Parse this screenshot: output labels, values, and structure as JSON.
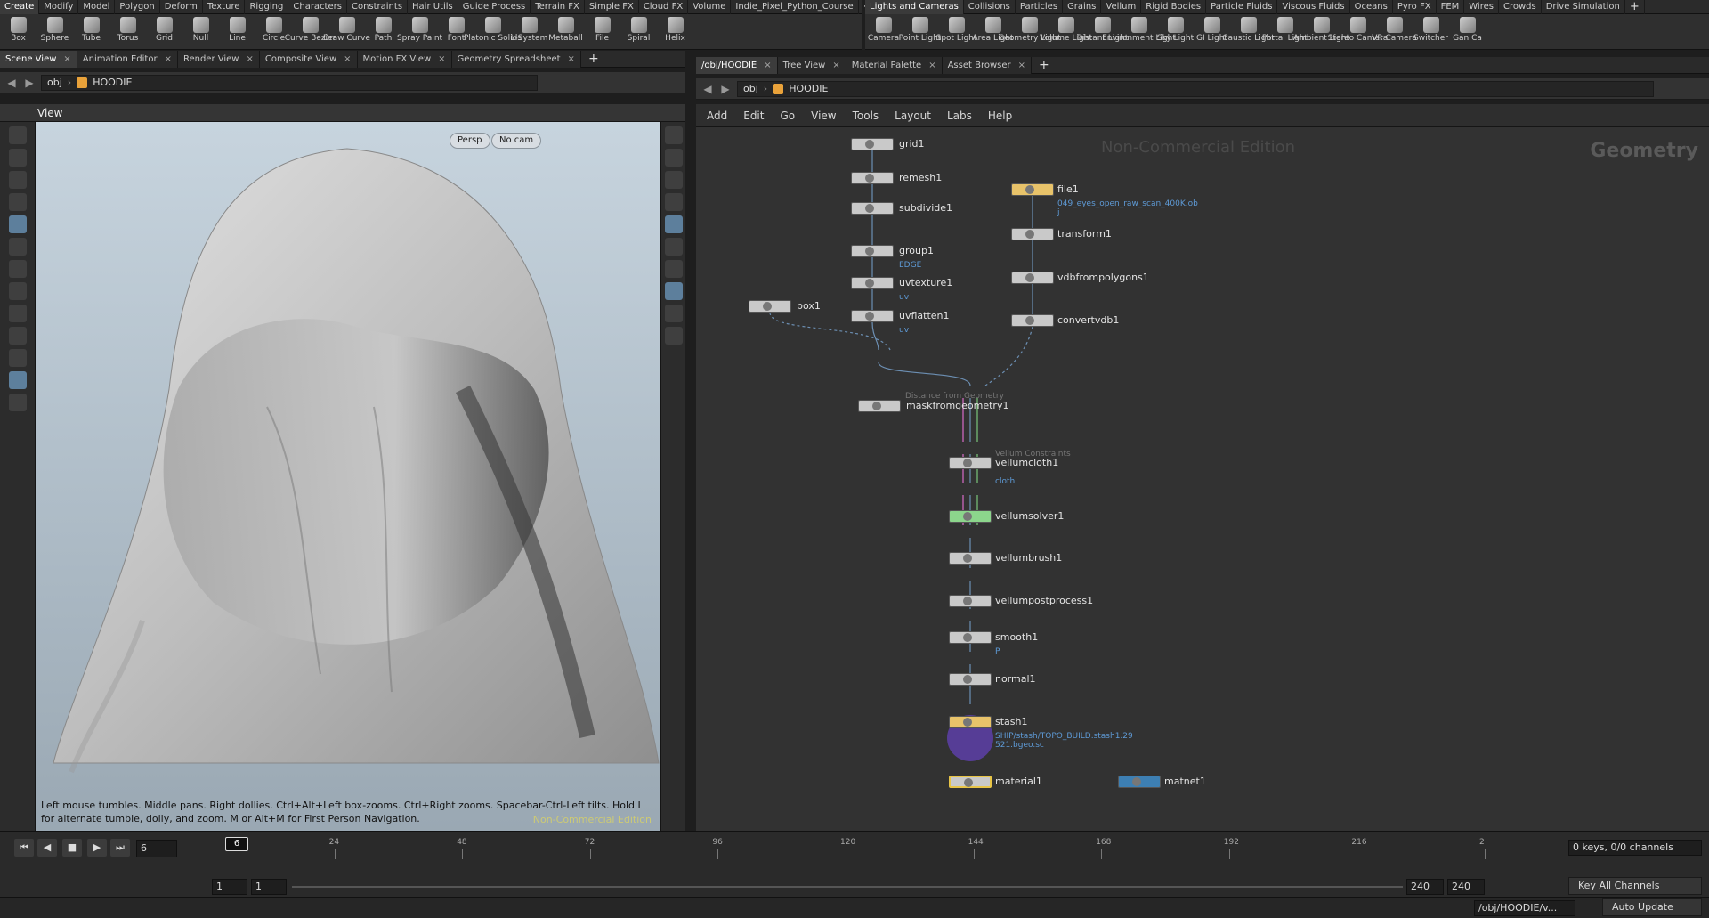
{
  "shelf_left": {
    "tabs": [
      "Create",
      "Modify",
      "Model",
      "Polygon",
      "Deform",
      "Texture",
      "Rigging",
      "Characters",
      "Constraints",
      "Hair Utils",
      "Guide Process",
      "Terrain FX",
      "Simple FX",
      "Cloud FX",
      "Volume",
      "Indie_Pixel_Python_Course"
    ],
    "tools": [
      "Box",
      "Sphere",
      "Tube",
      "Torus",
      "Grid",
      "Null",
      "Line",
      "Circle",
      "Curve Bezier",
      "Draw Curve",
      "Path",
      "Spray Paint",
      "Font",
      "Platonic Solids",
      "L-System",
      "Metaball",
      "File",
      "Spiral",
      "Helix"
    ]
  },
  "shelf_right": {
    "tabs": [
      "Lights and Cameras",
      "Collisions",
      "Particles",
      "Grains",
      "Vellum",
      "Rigid Bodies",
      "Particle Fluids",
      "Viscous Fluids",
      "Oceans",
      "Pyro FX",
      "FEM",
      "Wires",
      "Crowds",
      "Drive Simulation"
    ],
    "tools": [
      "Camera",
      "Point Light",
      "Spot Light",
      "Area Light",
      "Geometry Light",
      "Volume Light",
      "Distant Light",
      "Environment Light",
      "Sky Light",
      "GI Light",
      "Caustic Light",
      "Portal Light",
      "Ambient Light",
      "Stereo Camera",
      "VR Camera",
      "Switcher",
      "Gan Ca"
    ]
  },
  "left_pane": {
    "tabs": [
      "Scene View",
      "Animation Editor",
      "Render View",
      "Composite View",
      "Motion FX View",
      "Geometry Spreadsheet"
    ],
    "path": [
      "obj",
      "HOODIE"
    ],
    "view_title": "View",
    "persp": "Persp",
    "cam": "No cam",
    "help": "Left mouse tumbles. Middle pans. Right dollies. Ctrl+Alt+Left box-zooms. Ctrl+Right zooms. Spacebar-Ctrl-Left tilts. Hold L for alternate tumble, dolly, and zoom.    M or Alt+M for First Person Navigation.",
    "watermark": "Non-Commercial Edition"
  },
  "right_pane": {
    "tabs": [
      "/obj/HOODIE",
      "Tree View",
      "Material Palette",
      "Asset Browser"
    ],
    "path": [
      "obj",
      "HOODIE"
    ],
    "menu": [
      "Add",
      "Edit",
      "Go",
      "View",
      "Tools",
      "Layout",
      "Labs",
      "Help"
    ],
    "watermark": "Non-Commercial Edition",
    "context": "Geometry",
    "nodes": {
      "grid1": "grid1",
      "remesh1": "remesh1",
      "subdivide1": "subdivide1",
      "group1": "group1",
      "group1_sub": "EDGE",
      "uvtexture1": "uvtexture1",
      "uvtexture1_sub": "uv",
      "uvflatten1": "uvflatten1",
      "uvflatten1_sub": "uv",
      "box1": "box1",
      "mask_hint": "Distance from Geometry",
      "mask": "maskfromgeometry1",
      "file1": "file1",
      "file1_sub": "049_eyes_open_raw_scan_400K.ob j",
      "transform1": "transform1",
      "vdb": "vdbfrompolygons1",
      "convert": "convertvdb1",
      "vc_hint": "Vellum Constraints",
      "vellumcloth1": "vellumcloth1",
      "vellumcloth1_sub": "cloth",
      "vellumsolver1": "vellumsolver1",
      "vellumbrush1": "vellumbrush1",
      "vellumpost": "vellumpostprocess1",
      "smooth1": "smooth1",
      "smooth1_sub": "P",
      "normal1": "normal1",
      "stash1": "stash1",
      "stash1_sub": "SHIP/stash/TOPO_BUILD.stash1.29 521.bgeo.sc",
      "material1": "material1",
      "matnet1": "matnet1"
    }
  },
  "timeline": {
    "current_frame": "6",
    "ticks": [
      "24",
      "48",
      "72",
      "96",
      "120",
      "144",
      "168",
      "192",
      "216",
      "2"
    ],
    "start": "1",
    "start2": "1",
    "end": "240",
    "end2": "240",
    "keys": "0 keys, 0/0 channels",
    "key_all": "Key All Channels"
  },
  "status": {
    "path": "/obj/HOODIE/v...",
    "auto_update": "Auto Update"
  }
}
